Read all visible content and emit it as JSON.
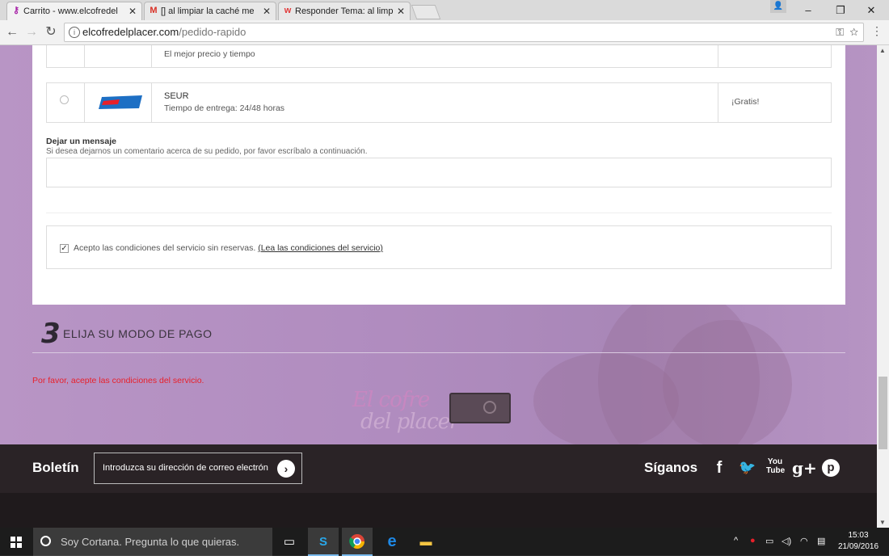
{
  "browser": {
    "tabs": [
      {
        "title": "Carrito - www.elcofredel",
        "close": "✕",
        "icon": "keyhole-favicon"
      },
      {
        "title": "[] al limpiar la caché me",
        "close": "✕",
        "icon": "gmail-favicon"
      },
      {
        "title": "Responder Tema: al limpi",
        "close": "✕",
        "icon": "w-favicon"
      }
    ],
    "url_domain": "elcofredelplacer.com",
    "url_path": "/pedido-rapido",
    "window_controls": {
      "minimize": "–",
      "restore": "❐",
      "close": "✕"
    }
  },
  "shipping": {
    "carriers": [
      {
        "name": "",
        "description": "El mejor precio y tiempo",
        "price": ""
      },
      {
        "name": "SEUR",
        "description": "Tiempo de entrega: 24/48 horas",
        "price": "¡Gratis!",
        "logo_text": "SEUR"
      }
    ]
  },
  "message": {
    "title": "Dejar un mensaje",
    "help": "Si desea dejarnos un comentario acerca de su pedido, por favor escríbalo a continuación.",
    "value": ""
  },
  "terms": {
    "checked": true,
    "text": "Acepto las condiciones del servicio sin reservas.",
    "link": "(Lea las condiciones del servicio)"
  },
  "payment_step": {
    "number": "3",
    "title": "ELIJA SU MODO DE PAGO",
    "error": "Por favor, acepte las condiciones del servicio."
  },
  "logo": {
    "line1": "El cofre",
    "line2": "del placer"
  },
  "footer": {
    "newsletter_label": "Boletín",
    "newsletter_placeholder": "Introduzca su dirección de correo electrón",
    "follow_label": "Síganos",
    "social": [
      {
        "name": "facebook",
        "glyph": "f"
      },
      {
        "name": "twitter",
        "glyph": "🐦"
      },
      {
        "name": "youtube",
        "glyph": "You Tube"
      },
      {
        "name": "google-plus",
        "glyph": "g+"
      },
      {
        "name": "pinterest",
        "glyph": "p"
      }
    ]
  },
  "taskbar": {
    "cortana_text": "Soy Cortana. Pregunta lo que quieras.",
    "time": "15:03",
    "date": "21/09/2016"
  },
  "colors": {
    "accent_error": "#e8202a",
    "footer_bg": "#2a2326",
    "page_bg": "#b38fc1"
  }
}
